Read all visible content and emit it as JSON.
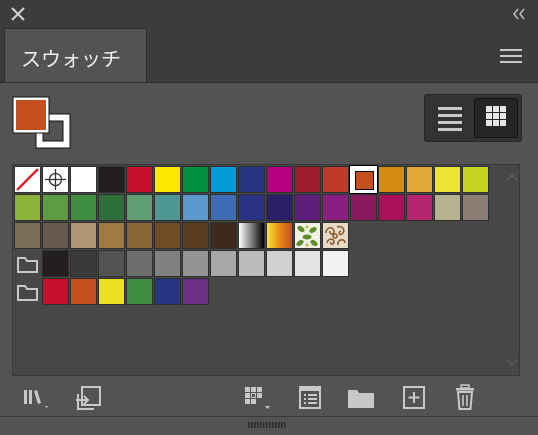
{
  "panel": {
    "tab_title": "スウォッチ"
  },
  "fill_color": "#c4501f",
  "view_mode": "grid",
  "swatch_rows": [
    [
      "none",
      "registration",
      "#ffffff",
      "#231f20",
      "#c8102e",
      "#ffe800",
      "#00923f",
      "#009bd9",
      "#283583",
      "#b5007f",
      "#9d1d2d",
      "#c0392b",
      "#c4501f",
      "#d68a10",
      "#e2a83a",
      "#ece333",
      "#c8d424"
    ],
    [
      "#8cb33a",
      "#5d9c42",
      "#3f8e42",
      "#2e6e3b",
      "#5e9e72",
      "#4f9795",
      "#5c99cf",
      "#3f6db3",
      "#2a3284",
      "#2b1e68",
      "#5d1f7b",
      "#8a1f81",
      "#8a1a5e",
      "#a8105a",
      "#b5246e",
      "#b8b190",
      "#8c7e74"
    ],
    [
      "#7a6e58",
      "#675b50",
      "#b09773",
      "#9f7a43",
      "#8a6537",
      "#6f4b26",
      "#5a3d1e",
      "#3e2a1d",
      "grad-bw",
      "grad-orange",
      "pattern-leaf",
      "pattern-paisley"
    ],
    [
      "folder",
      "#231f20",
      "#3a3a3a",
      "#535353",
      "#6e6e6e",
      "#808080",
      "#949494",
      "#a8a8a8",
      "#bcbcbc",
      "#d0d0d0",
      "#e3e3e3",
      "#f2f2f2"
    ],
    [
      "folder",
      "#c8102e",
      "#c4501f",
      "#ece120",
      "#3f8e42",
      "#283583",
      "#6b2f83"
    ]
  ],
  "toolbar": {
    "icons": [
      "libraries-icon",
      "place-swatch-icon",
      "swatch-kind-menu-icon",
      "swatch-options-icon",
      "new-color-group-icon",
      "new-swatch-icon",
      "delete-swatch-icon"
    ]
  }
}
